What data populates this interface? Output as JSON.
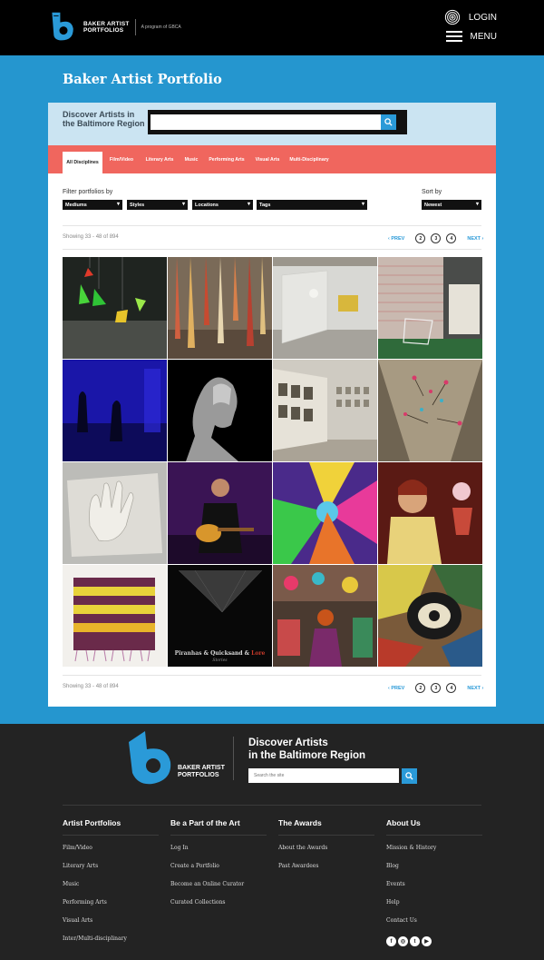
{
  "header": {
    "logo_line1": "BAKER ARTIST",
    "logo_line2": "PORTFOLIOS",
    "tagline": "A program of GBCA",
    "login_label": "LOGIN",
    "menu_label": "MENU"
  },
  "page": {
    "title": "Baker Artist Portfolio"
  },
  "discover": {
    "title": "Discover Artists in the Baltimore Region",
    "search_placeholder": ""
  },
  "tabs": [
    {
      "label": "All Disciplines",
      "active": true
    },
    {
      "label": "Film/Video"
    },
    {
      "label": "Literary Arts"
    },
    {
      "label": "Music"
    },
    {
      "label": "Performing Arts"
    },
    {
      "label": "Visual Arts"
    },
    {
      "label": "Multi-Disciplinary"
    }
  ],
  "filters": {
    "label": "Filter portfolios by",
    "selects": [
      "Mediums",
      "Styles",
      "Locations",
      "Tags"
    ],
    "sort_label": "Sort by",
    "sort_value": "Newest"
  },
  "pagination": {
    "showing": "Showing 33 - 48 of 894",
    "prev": "‹ PREV",
    "pages": [
      "2",
      "3",
      "4"
    ],
    "next": "NEXT ›"
  },
  "gallery": {
    "tile_8_caption_1": "Piranhas",
    "tile_8_caption_amp": "& Quicksand &",
    "tile_8_caption_2": "Lore",
    "tile_8_caption_sub": "Stories"
  },
  "footer": {
    "logo_line1": "BAKER ARTIST",
    "logo_line2": "PORTFOLIOS",
    "discover_line1": "Discover Artists",
    "discover_line2": "in the Baltimore Region",
    "search_placeholder": "Search the site",
    "columns": [
      {
        "title": "Artist Portfolios",
        "links": [
          "Film/Video",
          "Literary Arts",
          "Music",
          "Performing Arts",
          "Visual Arts",
          "Inter/Multi-disciplinary"
        ]
      },
      {
        "title": "Be a Part of the Art",
        "links": [
          "Log In",
          "Create a Portfolio",
          "Become an Online Curator",
          "Curated Collections"
        ]
      },
      {
        "title": "The Awards",
        "links": [
          "About the Awards",
          "Past Awardees"
        ]
      },
      {
        "title": "About Us",
        "links": [
          "Mission & History",
          "Blog",
          "Events",
          "Help",
          "Contact Us"
        ]
      }
    ],
    "social": [
      "facebook-icon",
      "instagram-icon",
      "twitter-icon",
      "youtube-icon"
    ]
  },
  "colors": {
    "brand_blue": "#2596cf",
    "tab_bar": "#f0665e",
    "discover_bg": "#cbe4f2",
    "footer_bg": "#232323"
  }
}
